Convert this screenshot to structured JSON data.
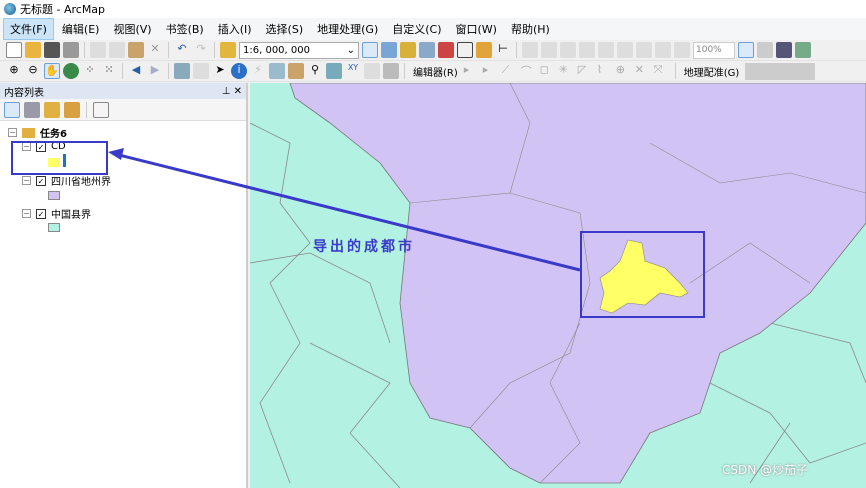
{
  "window": {
    "title": "无标题 - ArcMap"
  },
  "menu": [
    "文件(F)",
    "编辑(E)",
    "视图(V)",
    "书签(B)",
    "插入(I)",
    "选择(S)",
    "地理处理(G)",
    "自定义(C)",
    "窗口(W)",
    "帮助(H)"
  ],
  "toolbar": {
    "scale": "1:6, 000, 000",
    "zoom": "100%",
    "editor": "编辑器(R)",
    "georef": "地理配准(G)"
  },
  "toc": {
    "title": "内容列表",
    "root": "任务6",
    "layers": [
      {
        "name": "CD",
        "color": "#ffff66"
      },
      {
        "name": "四川省地州界",
        "color": "#d2c3f5"
      },
      {
        "name": "中国县界",
        "color": "#b3f2e3"
      }
    ]
  },
  "map": {
    "annotation": "导出的成都市",
    "watermark": "CSDN @炒茄子",
    "colors": {
      "background": "#b3f2e3",
      "sichuan": "#d2c3f5",
      "chengdu": "#ffff66",
      "highlight": "#3a3ac8"
    }
  }
}
